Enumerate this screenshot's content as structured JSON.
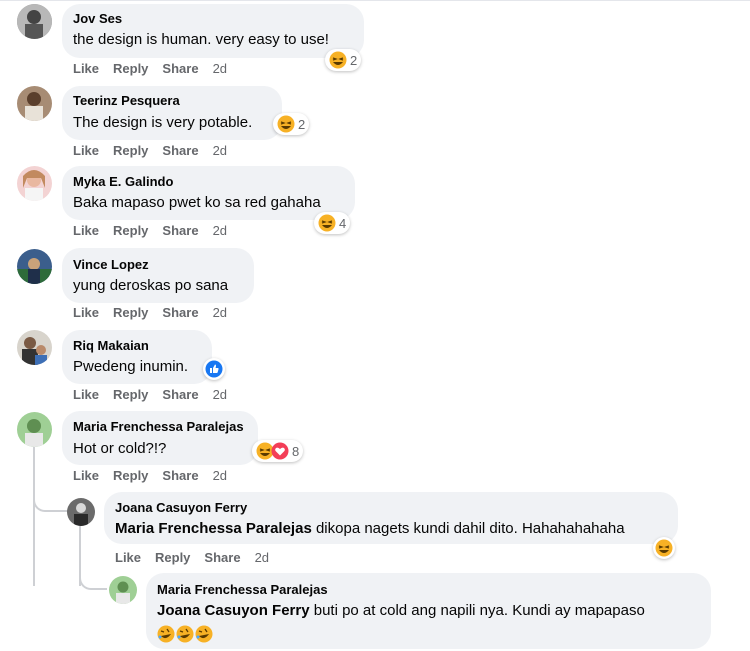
{
  "comments": [
    {
      "name": "Jov Ses",
      "text": "the design is human. very easy to use!",
      "actions": [
        "Like",
        "Reply",
        "Share"
      ],
      "time": "2d",
      "reaction_count": "2",
      "reactions": [
        "haha"
      ]
    },
    {
      "name": "Teerinz Pesquera",
      "text": "The design is very potable.",
      "actions": [
        "Like",
        "Reply",
        "Share"
      ],
      "time": "2d",
      "reaction_count": "2",
      "reactions": [
        "haha"
      ]
    },
    {
      "name": "Myka E. Galindo",
      "text": "Baka mapaso pwet ko sa red gahaha",
      "actions": [
        "Like",
        "Reply",
        "Share"
      ],
      "time": "2d",
      "reaction_count": "4",
      "reactions": [
        "haha"
      ]
    },
    {
      "name": "Vince Lopez",
      "text": "yung deroskas po sana",
      "actions": [
        "Like",
        "Reply",
        "Share"
      ],
      "time": "2d"
    },
    {
      "name": "Riq Makaian",
      "text": "Pwedeng inumin.",
      "actions": [
        "Like",
        "Reply",
        "Share"
      ],
      "time": "2d",
      "reactions": [
        "like"
      ]
    },
    {
      "name": "Maria Frenchessa Paralejas",
      "text": "Hot or cold?!?",
      "actions": [
        "Like",
        "Reply",
        "Share"
      ],
      "time": "2d",
      "reaction_count": "8",
      "reactions": [
        "haha",
        "love"
      ]
    }
  ],
  "replies": [
    {
      "name": "Joana Casuyon Ferry",
      "mention": "Maria Frenchessa Paralejas",
      "text": " dikopa nagets kundi dahil dito. Hahahahahaha",
      "actions": [
        "Like",
        "Reply",
        "Share"
      ],
      "time": "2d",
      "reactions": [
        "haha"
      ]
    },
    {
      "name": "Maria Frenchessa Paralejas",
      "mention": "Joana Casuyon Ferry",
      "text": " buti po at cold ang napili nya. Kundi ay mapapaso",
      "emoji_line": "🤣🤣🤣"
    }
  ],
  "colors": {
    "bubble": "#f0f2f5",
    "meta": "#65676b",
    "like_blue": "#1877f2",
    "haha_yellow": "#f7b125",
    "love_red": "#f33e58"
  }
}
